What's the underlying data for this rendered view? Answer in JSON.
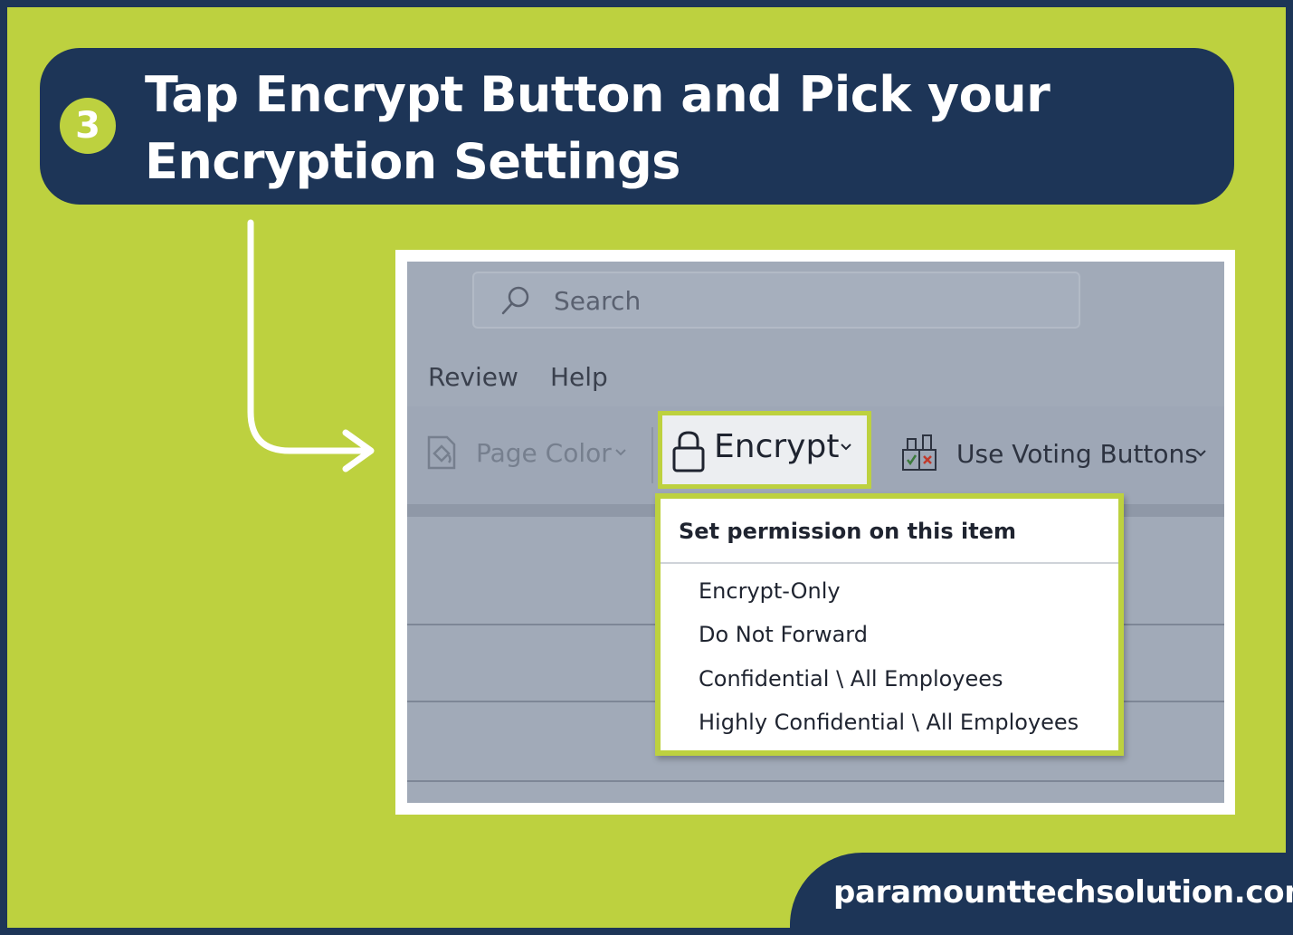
{
  "banner": {
    "step_number": "3",
    "title": "Tap Encrypt Button and Pick your Encryption Settings"
  },
  "screenshot": {
    "search": {
      "placeholder": "Search"
    },
    "tabs": [
      {
        "label": "Review"
      },
      {
        "label": "Help"
      }
    ],
    "ribbon": {
      "page_color_label": "Page Color",
      "encrypt_label": "Encrypt",
      "voting_label": "Use Voting Buttons"
    },
    "dropdown": {
      "header": "Set permission on this item",
      "items": [
        {
          "label": "Encrypt-Only"
        },
        {
          "label": "Do Not Forward"
        },
        {
          "label": "Confidential \\ All Employees"
        },
        {
          "label": "Highly Confidential \\ All Employees"
        }
      ]
    }
  },
  "footer": {
    "website": "paramounttechsolution.com"
  },
  "colors": {
    "navy": "#1d3557",
    "lime": "#bdd13f",
    "panel_gray": "#a1aab8",
    "white": "#ffffff"
  }
}
